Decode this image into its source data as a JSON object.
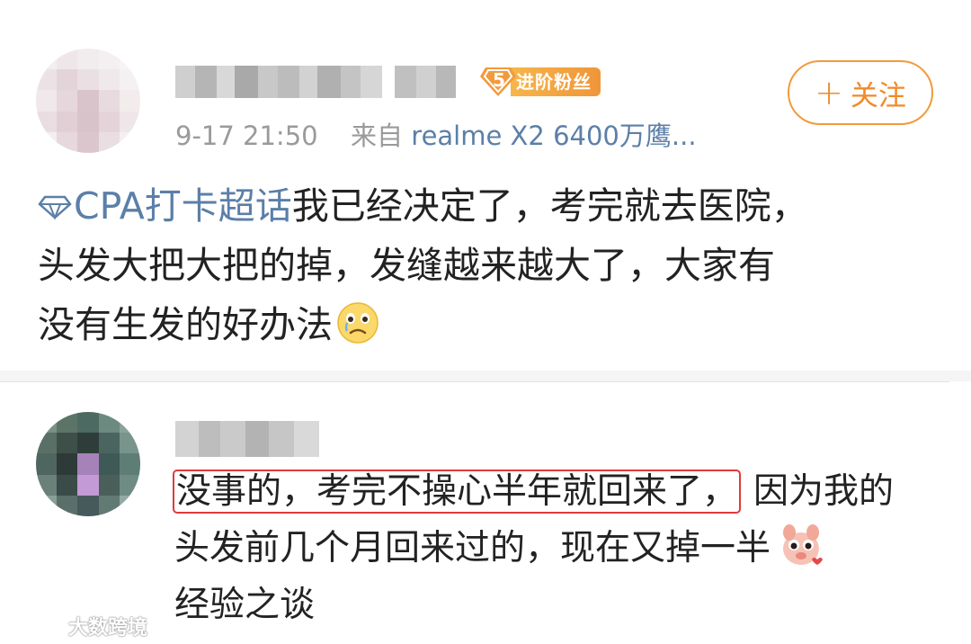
{
  "post": {
    "badge_level": "5",
    "badge_label": "进阶粉丝",
    "timestamp": "9-17 21:50",
    "source_prefix": "来自",
    "source_device": "realme X2 6400万鹰...",
    "follow_plus": "+",
    "follow_label": "关注",
    "topic": "CPA打卡超话",
    "body_line1": "我已经决定了，考完就去医院，",
    "body_line2": "头发大把大把的掉，发缝越来越大了，大家有",
    "body_line3": "没有生发的好办法",
    "emoji_icon": "crying-face-icon"
  },
  "comment": {
    "highlighted_text": "没事的，考完不操心半年就回来了，",
    "text_line1_rest": "因为我的",
    "text_line2": "头发前几个月回来过的，现在又掉一半",
    "text_line3": "经验之谈",
    "sticker_icon": "cute-pig-sticker-icon"
  },
  "watermark": {
    "text": "大数跨境"
  },
  "colors": {
    "accent_orange": "#f08a2a",
    "link_blue": "#5b7fa8",
    "highlight_red": "#e03a3a",
    "meta_gray": "#9a9a9a"
  }
}
